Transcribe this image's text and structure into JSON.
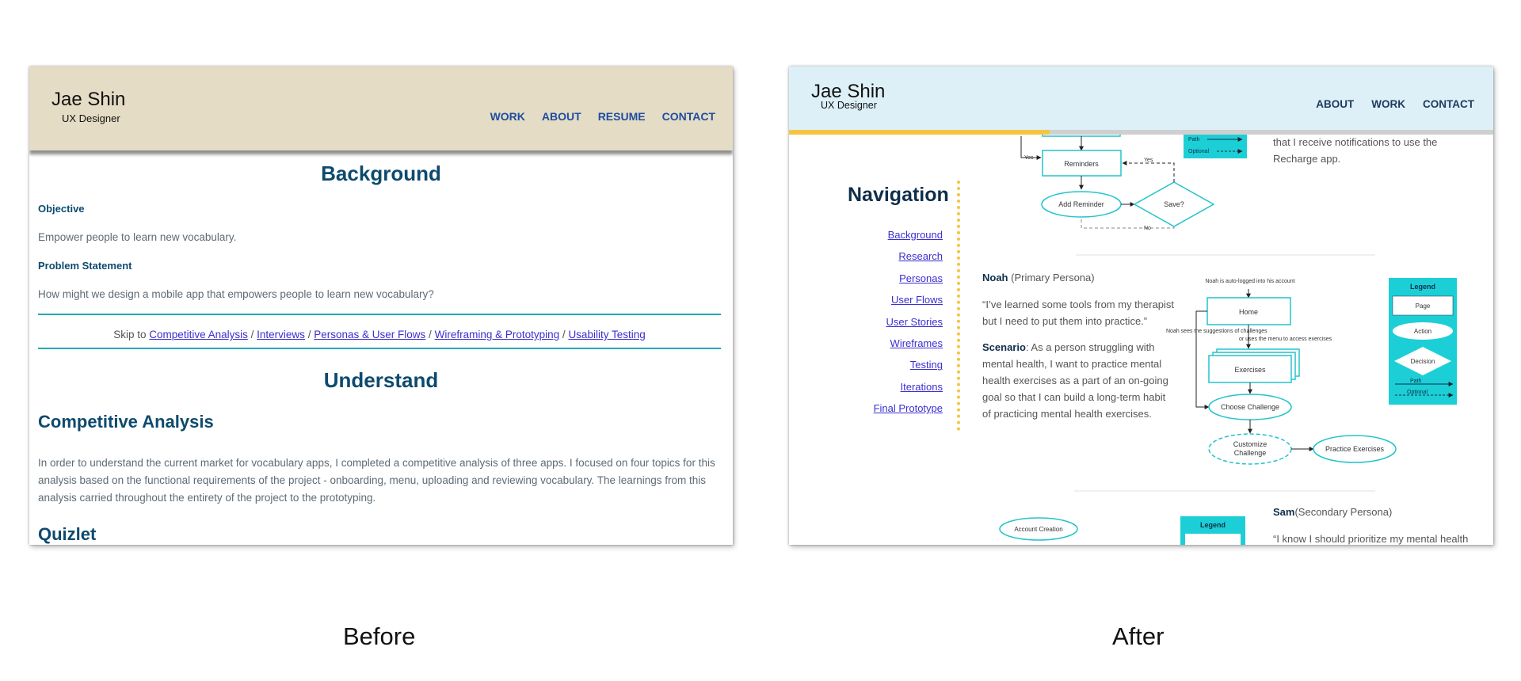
{
  "before": {
    "header": {
      "name": "Jae Shin",
      "role": "UX Designer",
      "nav": [
        "WORK",
        "ABOUT",
        "RESUME",
        "CONTACT"
      ],
      "bg_color": "#e5dcc5"
    },
    "background": {
      "title": "Background",
      "objective_label": "Objective",
      "objective_text": "Empower people to learn new vocabulary.",
      "problem_label": "Problem Statement",
      "problem_text": "How might we design a mobile app that empowers people to learn new vocabulary?"
    },
    "skip": {
      "prefix": "Skip to",
      "separator": "/",
      "links": [
        "Competitive Analysis",
        "Interviews",
        "Personas & User Flows",
        "Wireframing & Prototyping",
        "Usability Testing"
      ]
    },
    "understand": {
      "title": "Understand",
      "section_title": "Competitive Analysis",
      "paragraph": "In order to understand the current market for vocabulary apps, I completed a competitive analysis of three apps. I focused on four topics for this analysis based on the functional requirements of the project - onboarding, menu, uploading and reviewing vocabulary. The learnings from this analysis carried throughout the entirety of the project to the prototyping.",
      "next_heading": "Quizlet"
    }
  },
  "after": {
    "header": {
      "name": "Jae Shin",
      "role": "UX Designer",
      "nav": [
        "ABOUT",
        "WORK",
        "CONTACT"
      ],
      "bg_color": "#def0f7",
      "progress_fraction": 0.37
    },
    "sidebar": {
      "title": "Navigation",
      "links": [
        "Background",
        "Research",
        "Personas",
        "User Flows",
        "User Stories",
        "Wireframes",
        "Testing",
        "Iterations",
        "Final Prototype"
      ]
    },
    "top_note": "that I receive notifications to use the Recharge app.",
    "flow_top": {
      "reminders": "Reminders",
      "yes_left": "Yes",
      "yes_right": "Yes",
      "add_reminder": "Add Reminder",
      "save": "Save?",
      "no": "No",
      "legend_path": "Path",
      "legend_optional": "Optional"
    },
    "noah": {
      "name": "Noah",
      "tag": "(Primary Persona)",
      "quote": "“I’ve learned some tools from my therapist but I need to put them into practice.”",
      "scenario_label": "Scenario",
      "scenario_text": ": As a person struggling with mental health, I want to practice mental health exercises as a part of an on-going goal so that I can build a long-term habit of practicing mental health exercises."
    },
    "flow_noah": {
      "auto_login": "Noah is auto-logged into his account",
      "home": "Home",
      "suggestions": "Noah sees the suggestions of challenges",
      "menu_note": "or uses the menu to access exercises",
      "exercises": "Exercises",
      "choose_challenge": "Choose Challenge",
      "customize": "Customize Challenge",
      "practice": "Practice Exercises",
      "legend_title": "Legend",
      "legend_page": "Page",
      "legend_action": "Action",
      "legend_decision": "Decision",
      "legend_path": "Path",
      "legend_optional": "Optional"
    },
    "sam": {
      "name": "Sam",
      "tag": "(Secondary Persona)",
      "quote": "“I know I should prioritize my mental health"
    },
    "flow_sam": {
      "account_creation": "Account Creation",
      "legend_title": "Legend"
    },
    "colors": {
      "flow": "#22c4cc",
      "legend_bg": "#1ccfd6"
    }
  },
  "captions": {
    "before": "Before",
    "after": "After"
  }
}
